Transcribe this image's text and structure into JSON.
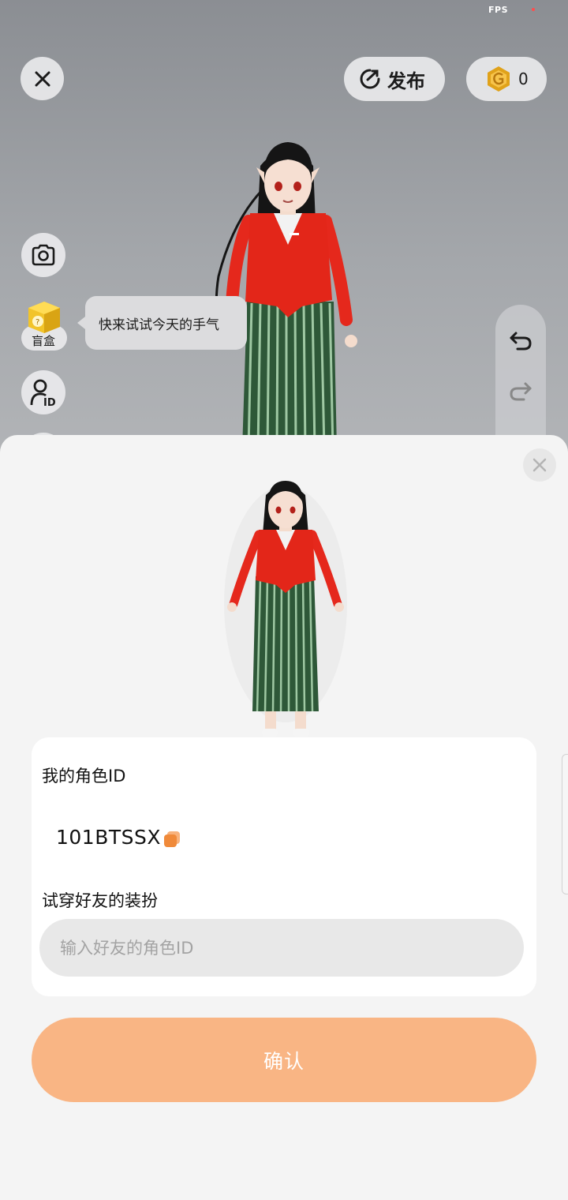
{
  "status": {
    "fps_label": "FPS"
  },
  "toolbar": {
    "publish_label": "发布",
    "coin_count": "0"
  },
  "side": {
    "blindbox_label": "盲盒",
    "tooltip": "快来试试今天的手气"
  },
  "sheet": {
    "my_id_label": "我的角色ID",
    "my_id_value": "101BTSSX",
    "try_label": "试穿好友的装扮",
    "input_placeholder": "输入好友的角色ID",
    "confirm_label": "确认"
  },
  "colors": {
    "accent": "#f9b584",
    "coin_gold": "#e0a21a",
    "jacket_red": "#e5281c",
    "skirt_green": "#2f5a3b"
  },
  "icons": [
    "close-icon",
    "publish-icon",
    "coin-icon",
    "camera-icon",
    "blindbox-icon",
    "avatar-id-icon",
    "undo-icon",
    "redo-icon",
    "copy-icon"
  ]
}
